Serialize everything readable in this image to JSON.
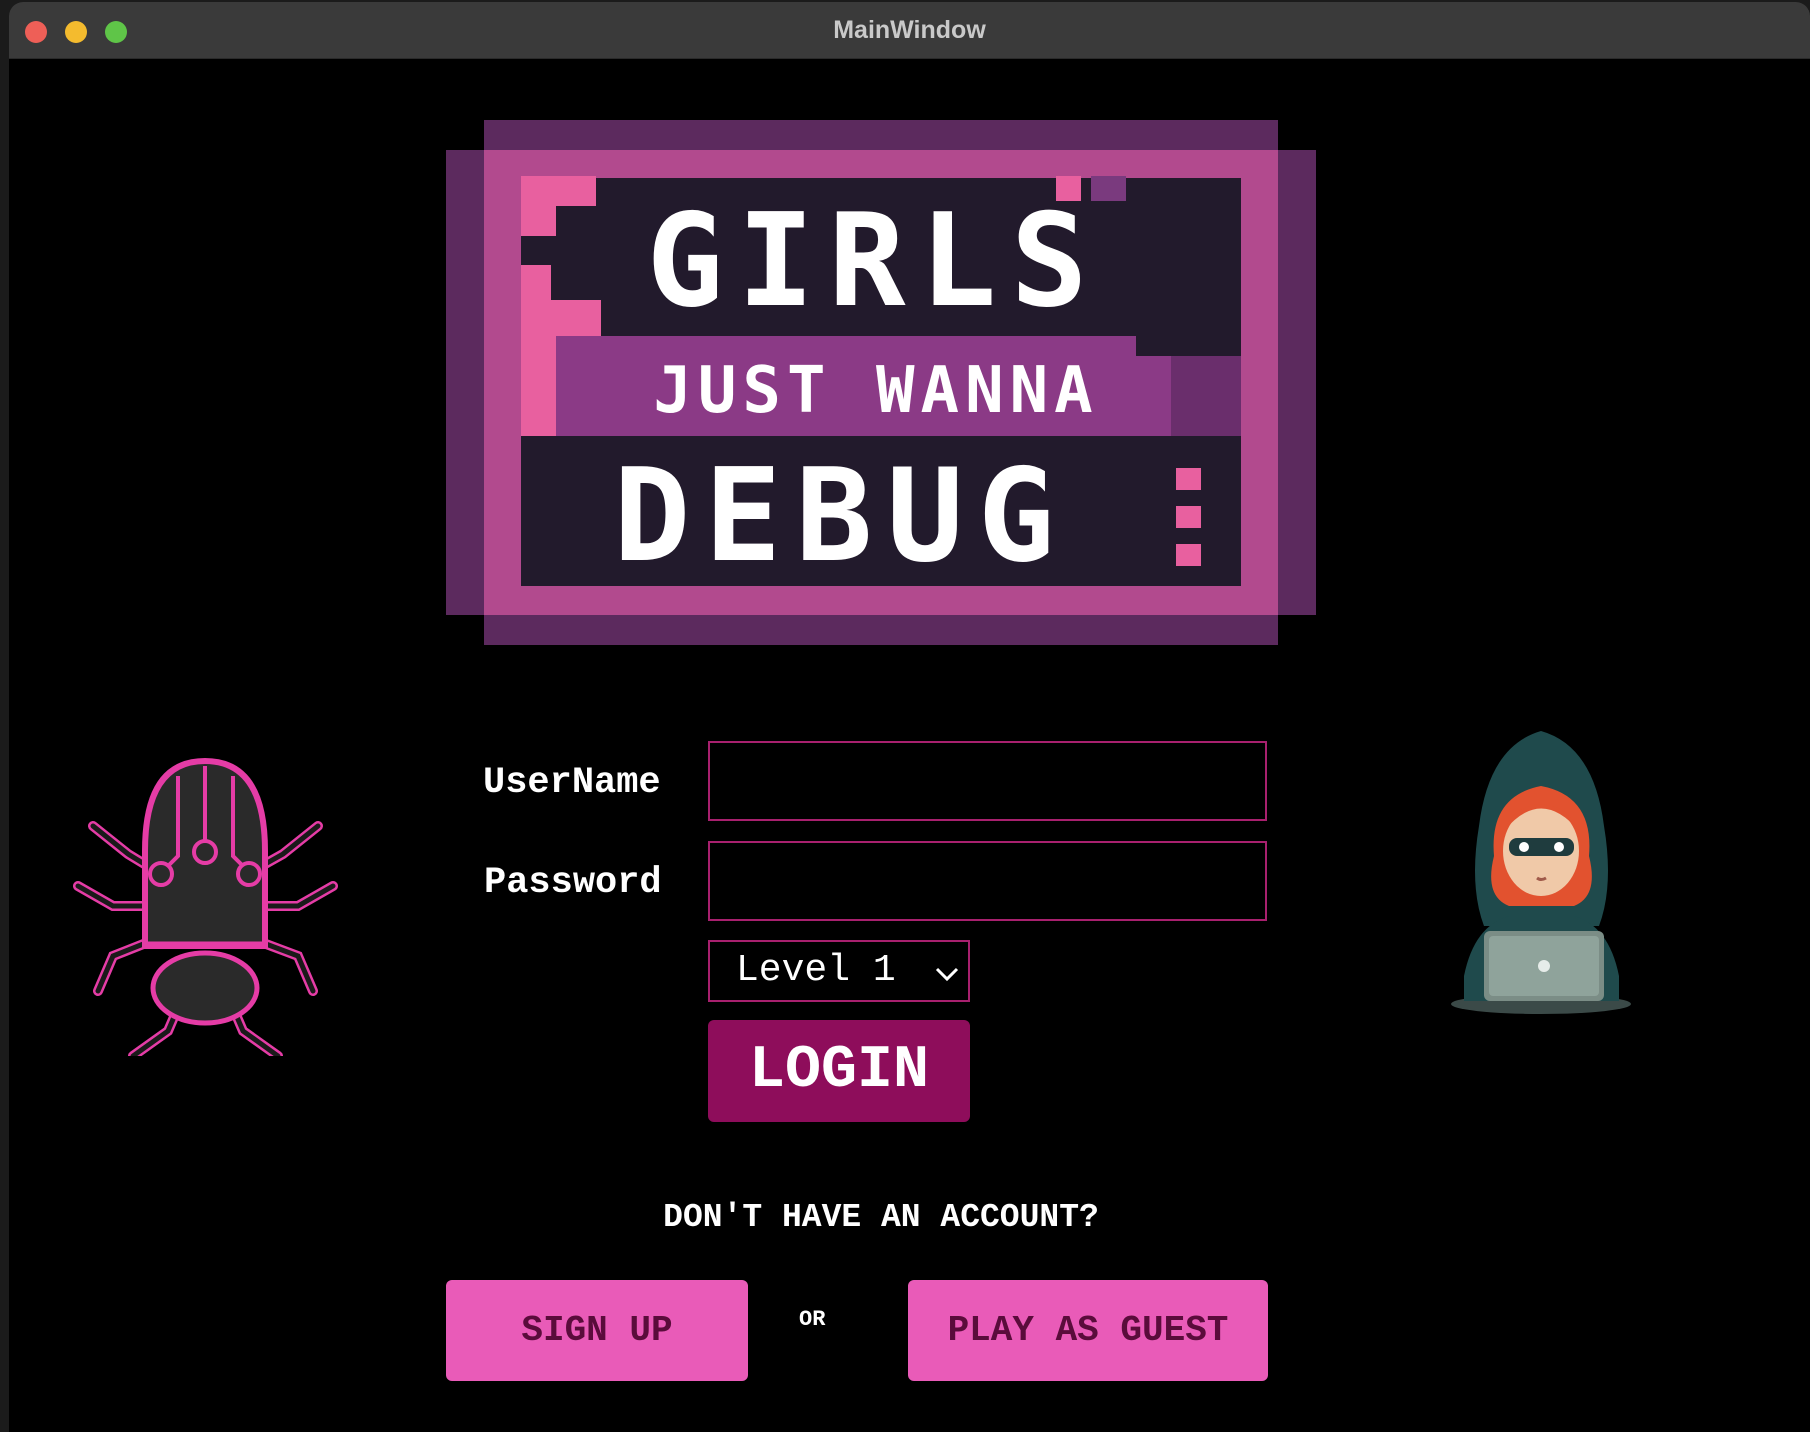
{
  "window": {
    "title": "MainWindow"
  },
  "logo": {
    "line1": "GIRLS",
    "line2": "JUST WANNA",
    "line3": "DEBUG"
  },
  "form": {
    "username_label": "UserName",
    "password_label": "Password",
    "username_value": "",
    "password_value": "",
    "level_selected": "Level 1",
    "login_label": "LOGIN"
  },
  "footer": {
    "prompt": "DON'T HAVE AN ACCOUNT?",
    "signup_label": "SIGN UP",
    "or_label": "OR",
    "guest_label": "PLAY AS GUEST"
  },
  "colors": {
    "accent": "#8e0d5b",
    "pink_button": "#e95bb8",
    "field_border": "#a8206e"
  },
  "icons": [
    "bug-icon",
    "hacker-girl-icon",
    "chevron-down-icon"
  ]
}
